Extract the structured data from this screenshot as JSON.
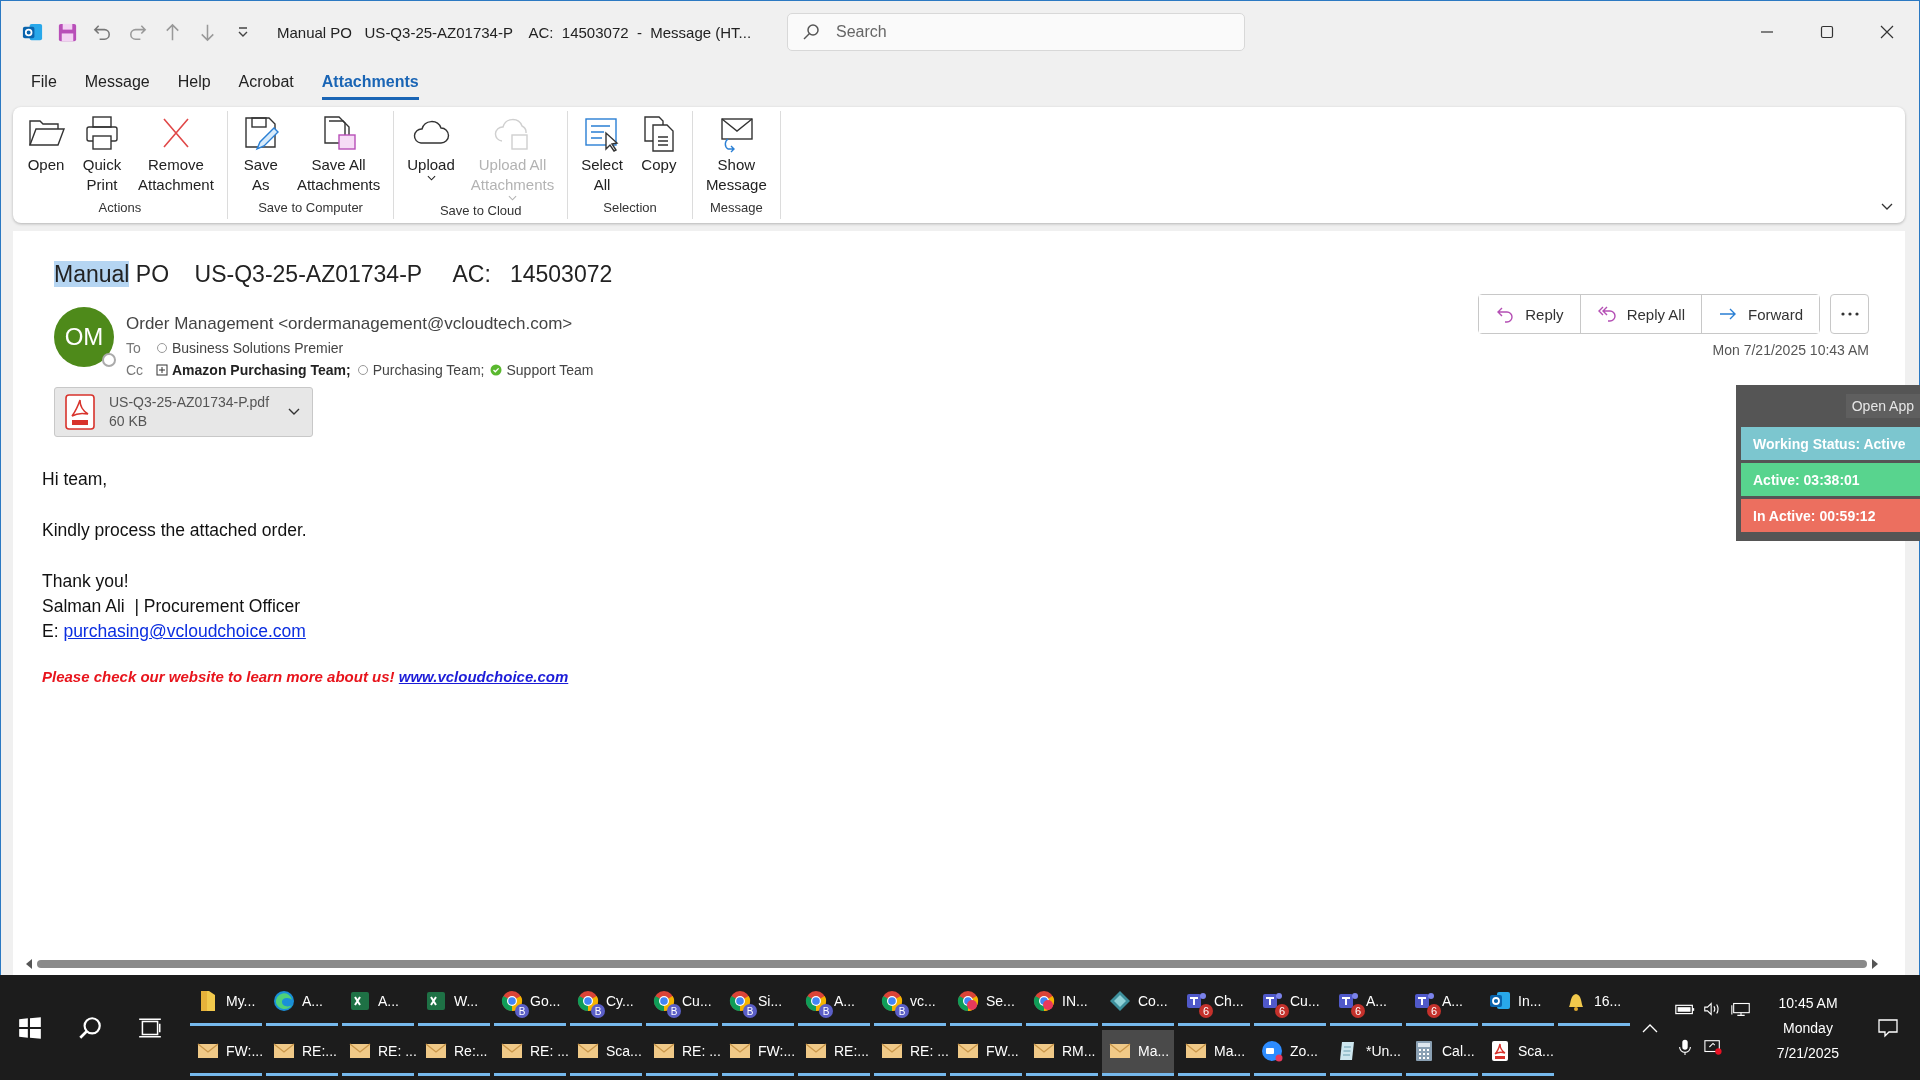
{
  "title_bar": {
    "title": "Manual PO   US-Q3-25-AZ01734-P    AC:  14503072  -  Message (HT...",
    "search": {
      "placeholder": "Search"
    }
  },
  "ribbon_tabs": [
    {
      "label": "File",
      "selected": false
    },
    {
      "label": "Message",
      "selected": false
    },
    {
      "label": "Help",
      "selected": false
    },
    {
      "label": "Acrobat",
      "selected": false
    },
    {
      "label": "Attachments",
      "selected": true
    }
  ],
  "ribbon_groups": [
    {
      "label": "Actions",
      "buttons": [
        {
          "label": "Open",
          "kind": "folder",
          "disabled": false,
          "dropdown": false
        },
        {
          "label": "Quick\nPrint",
          "kind": "printer",
          "disabled": false,
          "dropdown": false
        },
        {
          "label": "Remove\nAttachment",
          "kind": "remove",
          "disabled": false,
          "dropdown": false
        }
      ]
    },
    {
      "label": "Save to Computer",
      "buttons": [
        {
          "label": "Save\nAs",
          "kind": "save-as",
          "disabled": false,
          "dropdown": false
        },
        {
          "label": "Save All\nAttachments",
          "kind": "save-all",
          "disabled": false,
          "dropdown": false
        }
      ]
    },
    {
      "label": "Save to Cloud",
      "buttons": [
        {
          "label": "Upload",
          "kind": "cloud",
          "disabled": false,
          "dropdown": true
        },
        {
          "label": "Upload All\nAttachments",
          "kind": "cloud-save",
          "disabled": true,
          "dropdown": true
        }
      ]
    },
    {
      "label": "Selection",
      "buttons": [
        {
          "label": "Select\nAll",
          "kind": "select-all",
          "disabled": false,
          "dropdown": false
        },
        {
          "label": "Copy",
          "kind": "copy",
          "disabled": false,
          "dropdown": false
        }
      ]
    },
    {
      "label": "Message",
      "buttons": [
        {
          "label": "Show\nMessage",
          "kind": "envelope",
          "disabled": false,
          "dropdown": false
        }
      ]
    }
  ],
  "message": {
    "subject_highlight": "Manual",
    "subject_rest": " PO    US-Q3-25-AZ01734-P     AC:   14503072",
    "avatar": "OM",
    "sender": "Order Management <ordermanagement@vcloudtech.com>",
    "to_label": "To",
    "to": [
      {
        "name": "Business Solutions Premier",
        "kind": "offline"
      }
    ],
    "cc_label": "Cc",
    "cc": [
      {
        "name": "Amazon Purchasing Team;",
        "kind": "group"
      },
      {
        "name": "Purchasing Team;",
        "kind": "offline"
      },
      {
        "name": "Support Team",
        "kind": "available"
      }
    ],
    "actions": [
      {
        "label": "Reply",
        "kind": "reply"
      },
      {
        "label": "Reply All",
        "kind": "reply-all"
      },
      {
        "label": "Forward",
        "kind": "forward"
      }
    ],
    "date": "Mon 7/21/2025 10:43 AM",
    "attachment": {
      "name": "US-Q3-25-AZ01734-P.pdf",
      "size": "60 KB"
    },
    "body": [
      [
        {
          "kind": "text",
          "text": "Hi team,"
        }
      ],
      [
        {
          "kind": "text",
          "text": "Kindly process the attached order."
        }
      ],
      [
        {
          "kind": "text",
          "text": "Thank you!"
        },
        {
          "kind": "text",
          "text": "Salman Ali  | Procurement Officer"
        },
        {
          "kind": "email",
          "label": "E: ",
          "link": "purchasing@vcloudchoice.com"
        }
      ]
    ],
    "promo": {
      "text": "Please check our website to learn more about us! ",
      "link": "www.vcloudchoice.com"
    }
  },
  "tracker_widget": {
    "button": "Open App",
    "rows": [
      {
        "text": "Working Status: Active",
        "color": "#7cc6cf"
      },
      {
        "text": "Active: 03:38:01",
        "color": "#58d48e"
      },
      {
        "text": "In Active: 00:59:12",
        "color": "#ec6f5f"
      }
    ]
  },
  "taskbar": {
    "rows": [
      [
        {
          "label": "My...",
          "kind": "folder",
          "selected": false
        },
        {
          "label": "A...",
          "kind": "edge",
          "selected": false
        },
        {
          "label": "A...",
          "kind": "excel",
          "selected": false
        },
        {
          "label": "W...",
          "kind": "excel",
          "selected": false
        },
        {
          "label": "Go...",
          "kind": "chrome",
          "badge": "B",
          "selected": false
        },
        {
          "label": "Cy...",
          "kind": "chrome",
          "badge": "B",
          "selected": false
        },
        {
          "label": "Cu...",
          "kind": "chrome",
          "badge": "B",
          "selected": false
        },
        {
          "label": "Si...",
          "kind": "chrome",
          "badge": "B",
          "selected": false
        },
        {
          "label": "A...",
          "kind": "chrome",
          "badge": "B",
          "selected": false
        },
        {
          "label": "vc...",
          "kind": "chrome",
          "badge": "B",
          "selected": false
        },
        {
          "label": "Se...",
          "kind": "chrome-dot",
          "selected": false
        },
        {
          "label": "IN...",
          "kind": "chrome-dot",
          "selected": false
        },
        {
          "label": "Co...",
          "kind": "diamond",
          "selected": false
        },
        {
          "label": "Ch...",
          "kind": "teams",
          "badge": "6",
          "selected": false
        },
        {
          "label": "Cu...",
          "kind": "teams",
          "badge": "6",
          "selected": false
        },
        {
          "label": "A...",
          "kind": "teams",
          "badge": "6",
          "selected": false
        },
        {
          "label": "A...",
          "kind": "teams",
          "badge": "6",
          "selected": false
        },
        {
          "label": "In...",
          "kind": "outlook",
          "selected": false
        },
        {
          "label": "16...",
          "kind": "bell",
          "selected": false
        }
      ],
      [
        {
          "label": "FW:...",
          "kind": "mail",
          "selected": false
        },
        {
          "label": "RE:...",
          "kind": "mail",
          "selected": false
        },
        {
          "label": "RE: ...",
          "kind": "mail",
          "selected": false
        },
        {
          "label": "Re:...",
          "kind": "mail",
          "selected": false
        },
        {
          "label": "RE: ...",
          "kind": "mail",
          "selected": false
        },
        {
          "label": "Sca...",
          "kind": "mail",
          "selected": false
        },
        {
          "label": "RE: ...",
          "kind": "mail",
          "selected": false
        },
        {
          "label": "FW:...",
          "kind": "mail",
          "selected": false
        },
        {
          "label": "RE:...",
          "kind": "mail",
          "selected": false
        },
        {
          "label": "RE: ...",
          "kind": "mail",
          "selected": false
        },
        {
          "label": "FW...",
          "kind": "mail",
          "selected": false
        },
        {
          "label": "RM...",
          "kind": "mail",
          "selected": false
        },
        {
          "label": "Ma...",
          "kind": "mail",
          "selected": true
        },
        {
          "label": "Ma...",
          "kind": "mail",
          "selected": false
        },
        {
          "label": "Zo...",
          "kind": "zoom",
          "selected": false
        },
        {
          "label": "*Un...",
          "kind": "notepad",
          "selected": false
        },
        {
          "label": "Cal...",
          "kind": "calculator",
          "selected": false
        },
        {
          "label": "Sca...",
          "kind": "pdf",
          "selected": false
        }
      ]
    ],
    "clock": {
      "time": "10:45 AM",
      "day": "Monday",
      "date": "7/21/2025"
    }
  }
}
